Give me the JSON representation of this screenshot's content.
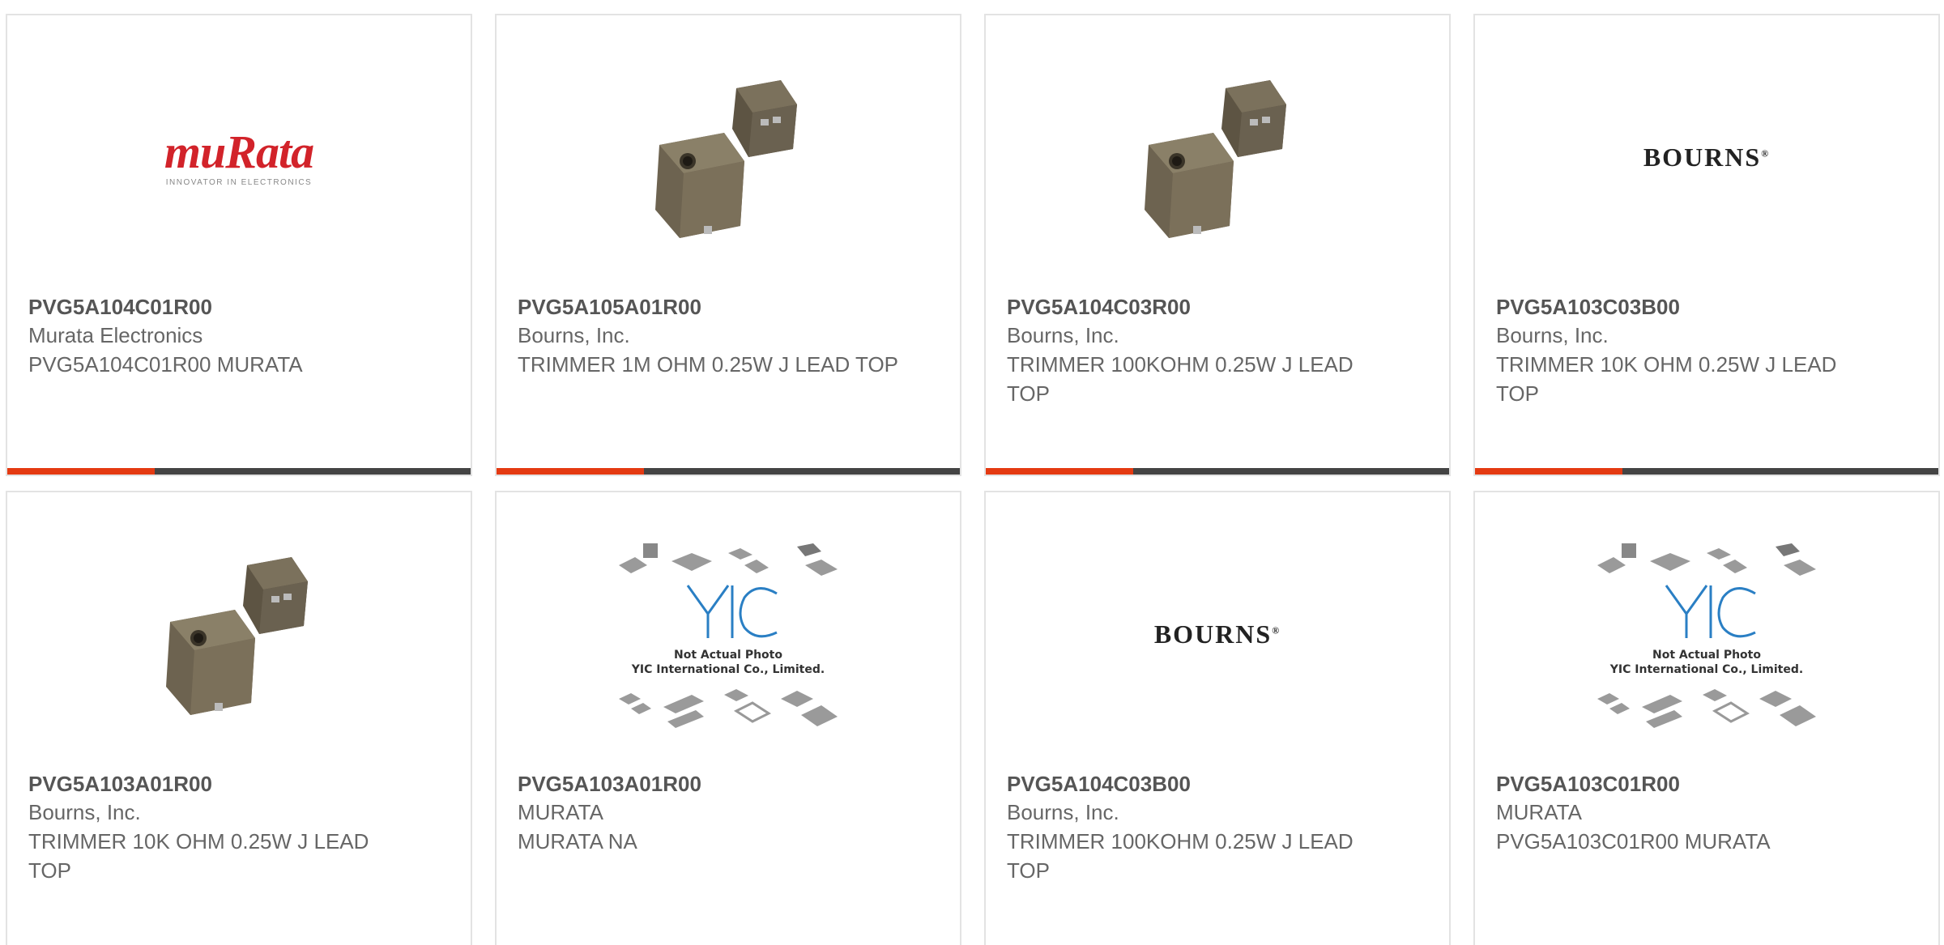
{
  "products": [
    {
      "part": "PVG5A104C01R00",
      "manufacturer": "Murata Electronics",
      "description": "PVG5A104C01R00 MURATA",
      "image": "murata-logo",
      "logo_text": "muRata",
      "logo_tagline": "INNOVATOR IN ELECTRONICS"
    },
    {
      "part": "PVG5A105A01R00",
      "manufacturer": "Bourns, Inc.",
      "description": "TRIMMER 1M OHM 0.25W J LEAD TOP",
      "image": "trimmer-photo"
    },
    {
      "part": "PVG5A104C03R00",
      "manufacturer": "Bourns, Inc.",
      "description": "TRIMMER 100KOHM 0.25W J LEAD TOP",
      "image": "trimmer-photo"
    },
    {
      "part": "PVG5A103C03B00",
      "manufacturer": "Bourns, Inc.",
      "description": "TRIMMER 10K OHM 0.25W J LEAD TOP",
      "image": "bourns-logo",
      "logo_text": "BOURNS"
    },
    {
      "part": "PVG5A103A01R00",
      "manufacturer": "Bourns, Inc.",
      "description": "TRIMMER 10K OHM 0.25W J LEAD TOP",
      "image": "trimmer-photo"
    },
    {
      "part": "PVG5A103A01R00",
      "manufacturer": "MURATA",
      "description": "MURATA NA",
      "image": "yic-placeholder",
      "placeholder_line1": "Not Actual Photo",
      "placeholder_line2": "YIC International Co., Limited."
    },
    {
      "part": "PVG5A104C03B00",
      "manufacturer": "Bourns, Inc.",
      "description": "TRIMMER 100KOHM 0.25W J LEAD TOP",
      "image": "bourns-logo",
      "logo_text": "BOURNS"
    },
    {
      "part": "PVG5A103C01R00",
      "manufacturer": "MURATA",
      "description": "PVG5A103C01R00 MURATA",
      "image": "yic-placeholder",
      "placeholder_line1": "Not Actual Photo",
      "placeholder_line2": "YIC International Co., Limited."
    }
  ],
  "colors": {
    "accent": "#e43a12",
    "bar": "#444444",
    "border": "#e3e3e3",
    "murata_red": "#d2232a",
    "yic_blue": "#2a7fc4"
  }
}
